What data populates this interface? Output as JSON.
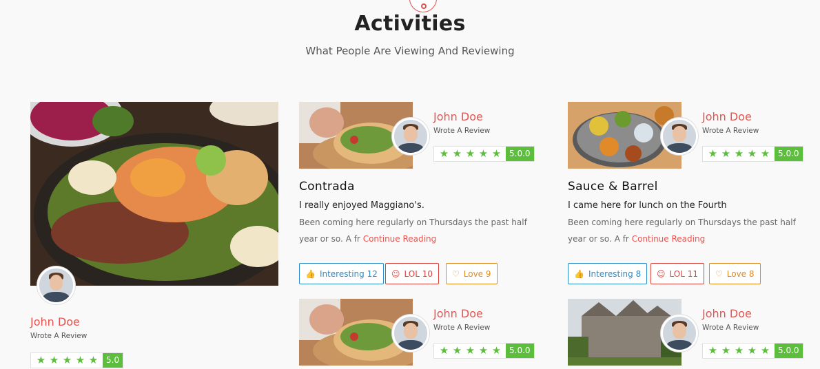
{
  "section": {
    "title": "Activities",
    "subtitle": "What People Are Viewing And Reviewing"
  },
  "featured": {
    "user": "John Doe",
    "action": "Wrote A Review",
    "score": "5.0"
  },
  "cards": [
    {
      "user": "John Doe",
      "action": "Wrote A Review",
      "score": "5.0.0",
      "title": "Contrada",
      "quote": "I really enjoyed Maggiano's.",
      "text": "Been coming here regularly on Thursdays the past half year or so. A fr",
      "read_more": "Continue Reading",
      "interesting": "Interesting 12",
      "lol": "LOL 10",
      "love": "Love 9"
    },
    {
      "user": "John Doe",
      "action": "Wrote A Review",
      "score": "5.0.0",
      "title": "Sauce & Barrel",
      "quote": "I came here for lunch on the Fourth",
      "text": "Been coming here regularly on Thursdays the past half year or so. A fr",
      "read_more": "Continue Reading",
      "interesting": "Interesting 8",
      "lol": "LOL 11",
      "love": "Love 8"
    },
    {
      "user": "John Doe",
      "action": "Wrote A Review",
      "score": "5.0.0"
    },
    {
      "user": "John Doe",
      "action": "Wrote A Review",
      "score": "5.0.0"
    }
  ],
  "colors": {
    "accent": "#e8534f",
    "rating": "#5cbf3b",
    "interesting": "#2a8bc9",
    "lol": "#d9413d",
    "love": "#e08a1e"
  }
}
